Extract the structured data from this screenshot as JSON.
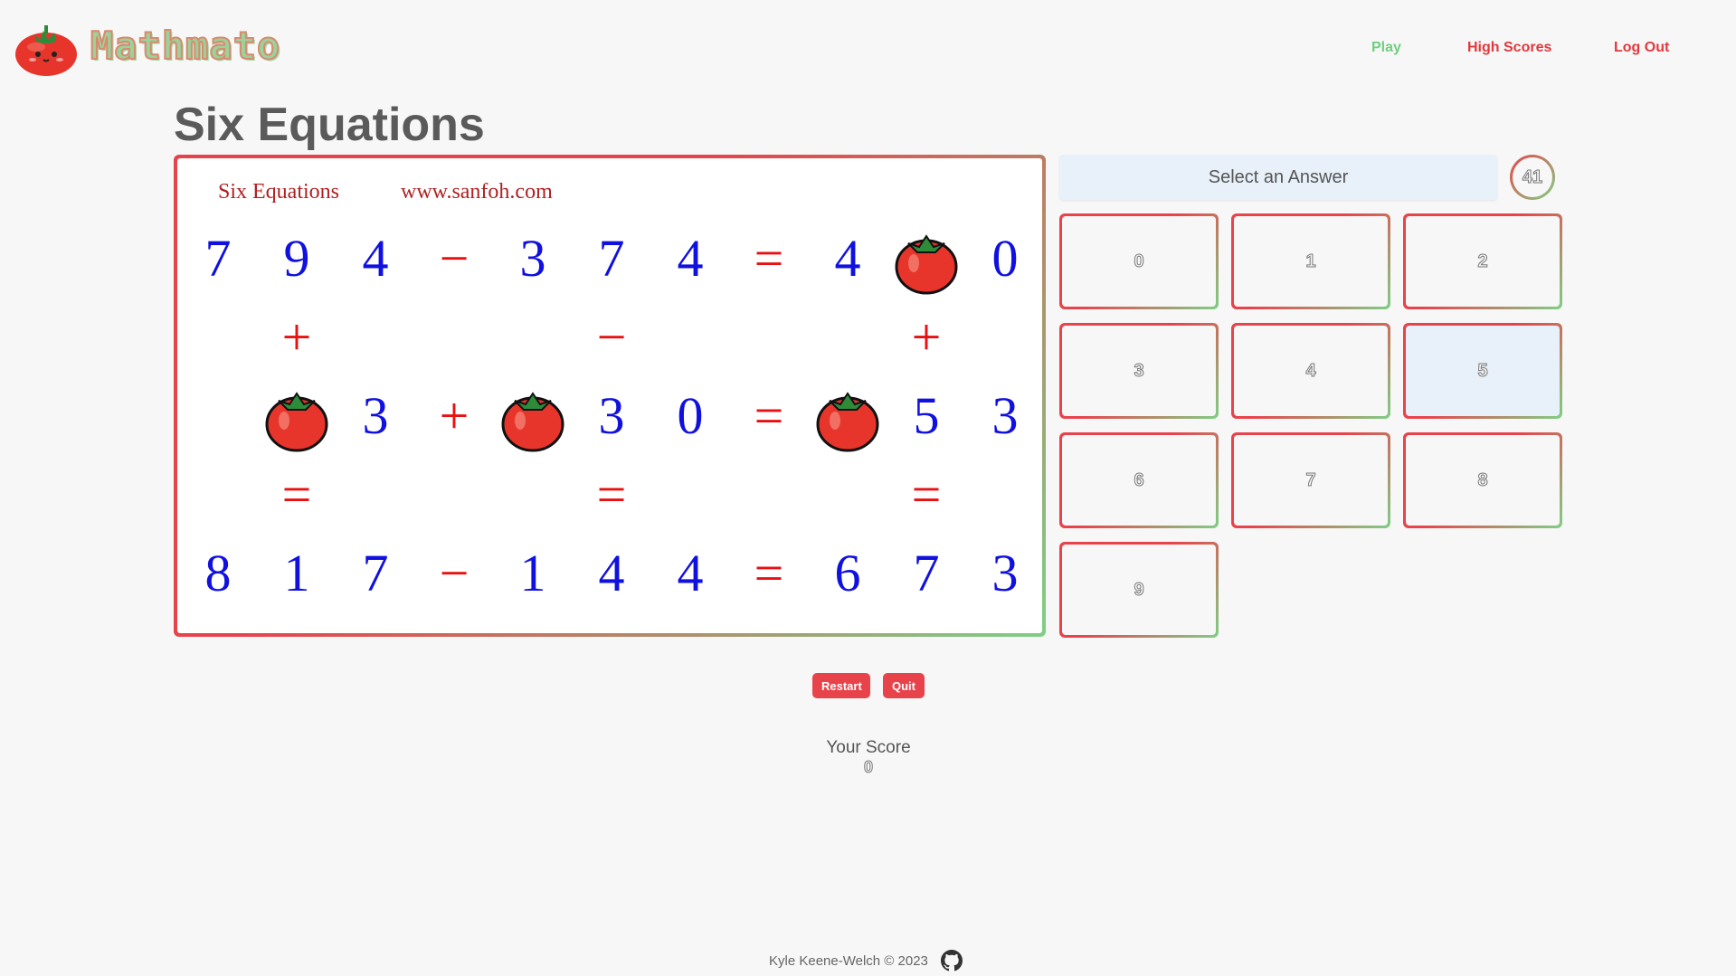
{
  "app": {
    "name": "Mathmato"
  },
  "nav": {
    "play": "Play",
    "high_scores": "High Scores",
    "log_out": "Log Out"
  },
  "page": {
    "title": "Six Equations"
  },
  "puzzle": {
    "header_left": "Six Equations",
    "header_right": "www.sanfoh.com",
    "rows": [
      [
        "7",
        "9",
        "4",
        "−",
        "3",
        "7",
        "4",
        "=",
        "4",
        "tomato",
        "0"
      ],
      [
        "",
        "+",
        "",
        "",
        "",
        "−",
        "",
        "",
        "",
        "+",
        ""
      ],
      [
        "",
        "tomato",
        "3",
        "+",
        "tomato",
        "3",
        "0",
        "=",
        "tomato",
        "5",
        "3"
      ],
      [
        "",
        "=",
        "",
        "",
        "",
        "=",
        "",
        "",
        "",
        "=",
        ""
      ],
      [
        "8",
        "1",
        "7",
        "−",
        "1",
        "4",
        "4",
        "=",
        "6",
        "7",
        "3"
      ]
    ],
    "colors": {
      "digit": "#1010e0",
      "operator": "#e81010",
      "header": "#b02020"
    }
  },
  "answer": {
    "prompt": "Select an Answer",
    "timer": "41",
    "options": [
      "0",
      "1",
      "2",
      "3",
      "4",
      "5",
      "6",
      "7",
      "8",
      "9"
    ],
    "selected": "5"
  },
  "controls": {
    "restart": "Restart",
    "quit": "Quit"
  },
  "score": {
    "label": "Your Score",
    "value": "0"
  },
  "footer": {
    "credit": "Kyle Keene-Welch © 2023",
    "icon": "github-icon"
  },
  "theme": {
    "red": "#e8434b",
    "green": "#7fcf85",
    "selected_bg": "#e8f0f9"
  }
}
